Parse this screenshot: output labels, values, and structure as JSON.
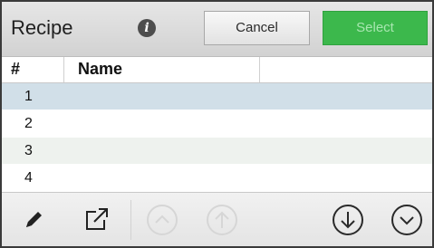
{
  "header": {
    "title": "Recipe",
    "info_icon": "info-icon",
    "cancel_label": "Cancel",
    "select_label": "Select",
    "select_color": "#3cb84c"
  },
  "table": {
    "columns": [
      "#",
      "Name"
    ],
    "rows": [
      {
        "num": "1",
        "name": "",
        "selected": true
      },
      {
        "num": "2",
        "name": "",
        "selected": false
      },
      {
        "num": "3",
        "name": "",
        "selected": false
      },
      {
        "num": "4",
        "name": "",
        "selected": false
      }
    ],
    "selected_color": "#d1dfe8"
  },
  "toolbar": {
    "icons": [
      "edit-icon",
      "export-icon",
      "move-top-icon",
      "move-up-icon",
      "move-down-icon",
      "move-bottom-icon"
    ]
  }
}
